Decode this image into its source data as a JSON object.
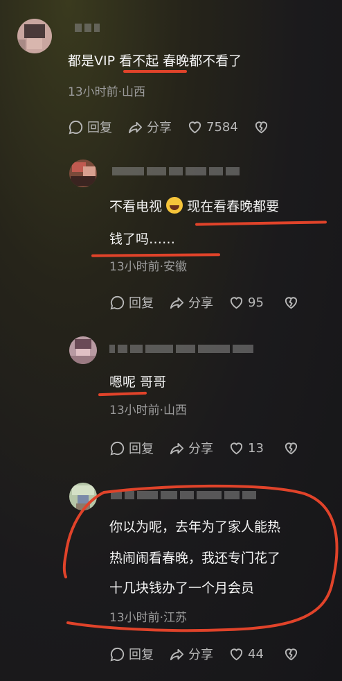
{
  "comments": [
    {
      "text_parts": [
        "都是VIP ",
        "看不起",
        " 春晚都不看了"
      ],
      "meta": "13小时前·山西",
      "reply": "回复",
      "share": "分享",
      "likes": "7584"
    },
    {
      "line1_a": "不看电视 ",
      "line1_b": " 现在看春晚都要",
      "line2": "钱了吗……",
      "meta": "13小时前·安徽",
      "reply": "回复",
      "share": "分享",
      "likes": "95"
    },
    {
      "text_a": "嗯呢",
      "text_b": " 哥哥",
      "meta": "13小时前·山西",
      "reply": "回复",
      "share": "分享",
      "likes": "13"
    },
    {
      "line1": "你以为呢，去年为了家人能热",
      "line2": "热闹闹看春晚，我还专门花了",
      "line3": "十几块钱办了一个月会员",
      "meta": "13小时前·江苏",
      "reply": "回复",
      "share": "分享",
      "likes": "44"
    }
  ],
  "colors": {
    "annotation": "#e0432a",
    "meta": "#9b9b9b",
    "text": "#f3f3f3"
  }
}
